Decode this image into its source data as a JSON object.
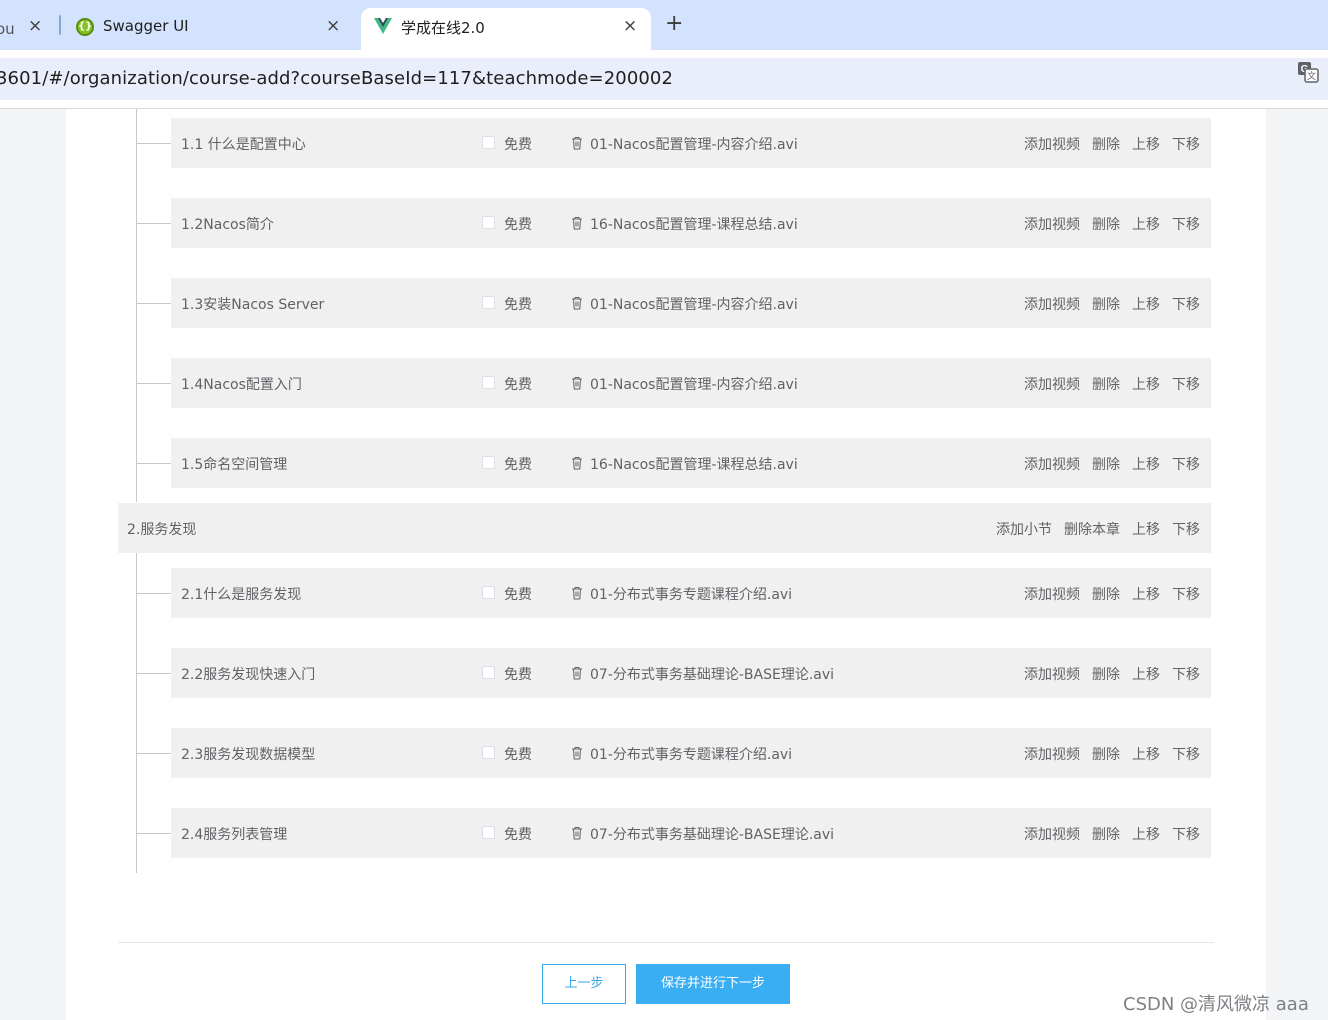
{
  "browser": {
    "tabs": [
      {
        "label": "ou",
        "close": "×"
      },
      {
        "label": "Swagger UI",
        "close": "×"
      },
      {
        "label": "学成在线2.0",
        "close": "×"
      }
    ],
    "new_tab": "+",
    "url": "3601/#/organization/course-add?courseBaseId=117&teachmode=200002"
  },
  "chapters": [
    {
      "sections": [
        {
          "title": "1.1 什么是配置中心",
          "free": "免费",
          "media": "01-Nacos配置管理-内容介绍.avi"
        },
        {
          "title": "1.2Nacos简介",
          "free": "免费",
          "media": "16-Nacos配置管理-课程总结.avi"
        },
        {
          "title": "1.3安装Nacos Server",
          "free": "免费",
          "media": "01-Nacos配置管理-内容介绍.avi"
        },
        {
          "title": "1.4Nacos配置入门",
          "free": "免费",
          "media": "01-Nacos配置管理-内容介绍.avi"
        },
        {
          "title": "1.5命名空间管理",
          "free": "免费",
          "media": "16-Nacos配置管理-课程总结.avi"
        }
      ]
    },
    {
      "title": "2.服务发现",
      "actions": {
        "add": "添加小节",
        "delete": "删除本章",
        "up": "上移",
        "down": "下移"
      },
      "sections": [
        {
          "title": "2.1什么是服务发现",
          "free": "免费",
          "media": "01-分布式事务专题课程介绍.avi"
        },
        {
          "title": "2.2服务发现快速入门",
          "free": "免费",
          "media": "07-分布式事务基础理论-BASE理论.avi"
        },
        {
          "title": "2.3服务发现数据模型",
          "free": "免费",
          "media": "01-分布式事务专题课程介绍.avi"
        },
        {
          "title": "2.4服务列表管理",
          "free": "免费",
          "media": "07-分布式事务基础理论-BASE理论.avi"
        }
      ]
    }
  ],
  "section_actions": {
    "add_video": "添加视频",
    "delete": "删除",
    "up": "上移",
    "down": "下移"
  },
  "footer": {
    "prev": "上一步",
    "next": "保存并进行下一步"
  },
  "watermark": "CSDN @清风微凉 aaa",
  "colors": {
    "primary": "#3aaef2",
    "row_bg": "#f0f0f0",
    "tab_bar": "#d3e3fd"
  }
}
